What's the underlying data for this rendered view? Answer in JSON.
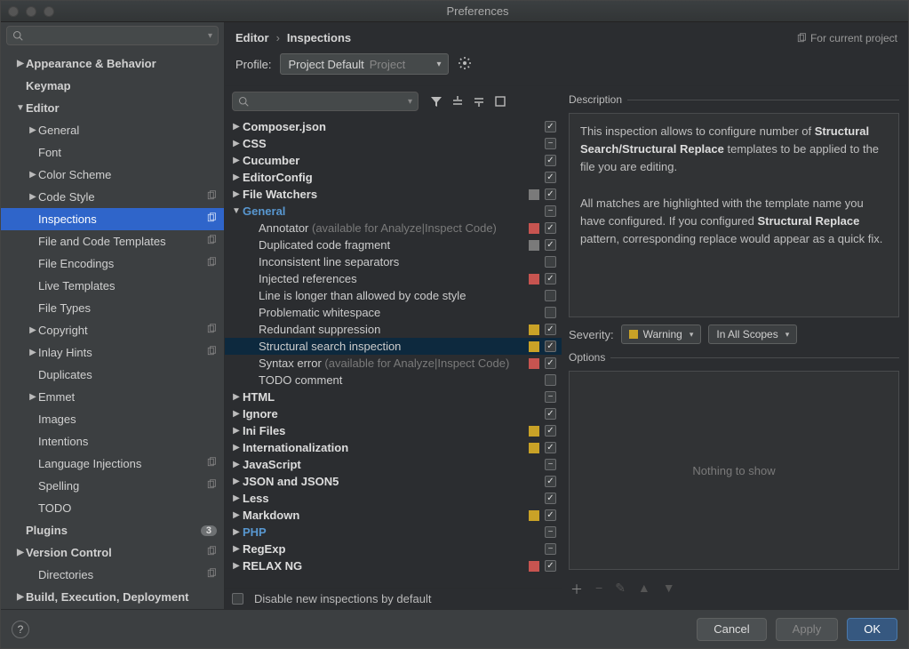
{
  "window": {
    "title": "Preferences"
  },
  "sidebar": {
    "search_placeholder": "",
    "groups": [
      {
        "label": "Appearance & Behavior",
        "bold": true,
        "indent": 0,
        "arrow": "▶"
      },
      {
        "label": "Keymap",
        "bold": true,
        "indent": 0
      },
      {
        "label": "Editor",
        "bold": true,
        "indent": 0,
        "arrow": "▼"
      },
      {
        "label": "General",
        "indent": 1,
        "arrow": "▶"
      },
      {
        "label": "Font",
        "indent": 1
      },
      {
        "label": "Color Scheme",
        "indent": 1,
        "arrow": "▶"
      },
      {
        "label": "Code Style",
        "indent": 1,
        "arrow": "▶",
        "copy": true
      },
      {
        "label": "Inspections",
        "indent": 1,
        "selected": true,
        "copy": true
      },
      {
        "label": "File and Code Templates",
        "indent": 1,
        "copy": true
      },
      {
        "label": "File Encodings",
        "indent": 1,
        "copy": true
      },
      {
        "label": "Live Templates",
        "indent": 1
      },
      {
        "label": "File Types",
        "indent": 1
      },
      {
        "label": "Copyright",
        "indent": 1,
        "arrow": "▶",
        "copy": true
      },
      {
        "label": "Inlay Hints",
        "indent": 1,
        "arrow": "▶",
        "copy": true
      },
      {
        "label": "Duplicates",
        "indent": 1
      },
      {
        "label": "Emmet",
        "indent": 1,
        "arrow": "▶"
      },
      {
        "label": "Images",
        "indent": 1
      },
      {
        "label": "Intentions",
        "indent": 1
      },
      {
        "label": "Language Injections",
        "indent": 1,
        "copy": true
      },
      {
        "label": "Spelling",
        "indent": 1,
        "copy": true
      },
      {
        "label": "TODO",
        "indent": 1
      },
      {
        "label": "Plugins",
        "bold": true,
        "indent": 0,
        "badge": "3"
      },
      {
        "label": "Version Control",
        "bold": true,
        "indent": 0,
        "arrow": "▶",
        "copy": true
      },
      {
        "label": "Directories",
        "indent": 1,
        "copy": true
      },
      {
        "label": "Build, Execution, Deployment",
        "bold": true,
        "indent": 0,
        "arrow": "▶"
      }
    ]
  },
  "breadcrumb": {
    "a": "Editor",
    "sep": "›",
    "b": "Inspections",
    "current_project": "For current project"
  },
  "profile": {
    "label": "Profile:",
    "name": "Project Default",
    "scope": "Project"
  },
  "inspections": {
    "items": [
      {
        "label": "Composer.json",
        "bold": true,
        "indent": 0,
        "arrow": "▶",
        "cb": "checked"
      },
      {
        "label": "CSS",
        "bold": true,
        "indent": 0,
        "arrow": "▶",
        "cb": "mixed"
      },
      {
        "label": "Cucumber",
        "bold": true,
        "indent": 0,
        "arrow": "▶",
        "cb": "checked"
      },
      {
        "label": "EditorConfig",
        "bold": true,
        "indent": 0,
        "arrow": "▶",
        "cb": "checked"
      },
      {
        "label": "File Watchers",
        "bold": true,
        "indent": 0,
        "arrow": "▶",
        "sev": "none",
        "cb": "checked"
      },
      {
        "label": "General",
        "bold": true,
        "blue": true,
        "indent": 0,
        "arrow": "▼",
        "cb": "mixed"
      },
      {
        "label": "Annotator",
        "dim": "(available for Analyze|Inspect Code)",
        "indent": 1,
        "sev": "err",
        "cb": "checked"
      },
      {
        "label": "Duplicated code fragment",
        "indent": 1,
        "sev": "none",
        "cb": "checked"
      },
      {
        "label": "Inconsistent line separators",
        "indent": 1,
        "cb": ""
      },
      {
        "label": "Injected references",
        "indent": 1,
        "sev": "err",
        "cb": "checked"
      },
      {
        "label": "Line is longer than allowed by code style",
        "indent": 1,
        "cb": ""
      },
      {
        "label": "Problematic whitespace",
        "indent": 1,
        "cb": ""
      },
      {
        "label": "Redundant suppression",
        "indent": 1,
        "sev": "warn",
        "cb": "checked"
      },
      {
        "label": "Structural search inspection",
        "indent": 1,
        "sev": "warn",
        "cb": "checked",
        "selected": true
      },
      {
        "label": "Syntax error",
        "dim": "(available for Analyze|Inspect Code)",
        "indent": 1,
        "sev": "err",
        "cb": "checked"
      },
      {
        "label": "TODO comment",
        "indent": 1,
        "cb": ""
      },
      {
        "label": "HTML",
        "bold": true,
        "indent": 0,
        "arrow": "▶",
        "cb": "mixed"
      },
      {
        "label": "Ignore",
        "bold": true,
        "indent": 0,
        "arrow": "▶",
        "cb": "checked"
      },
      {
        "label": "Ini Files",
        "bold": true,
        "indent": 0,
        "arrow": "▶",
        "sev": "warn",
        "cb": "checked"
      },
      {
        "label": "Internationalization",
        "bold": true,
        "indent": 0,
        "arrow": "▶",
        "sev": "warn",
        "cb": "checked"
      },
      {
        "label": "JavaScript",
        "bold": true,
        "indent": 0,
        "arrow": "▶",
        "cb": "mixed"
      },
      {
        "label": "JSON and JSON5",
        "bold": true,
        "indent": 0,
        "arrow": "▶",
        "cb": "checked"
      },
      {
        "label": "Less",
        "bold": true,
        "indent": 0,
        "arrow": "▶",
        "cb": "checked"
      },
      {
        "label": "Markdown",
        "bold": true,
        "indent": 0,
        "arrow": "▶",
        "sev": "warn",
        "cb": "checked"
      },
      {
        "label": "PHP",
        "bold": true,
        "blue": true,
        "indent": 0,
        "arrow": "▶",
        "cb": "mixed"
      },
      {
        "label": "RegExp",
        "bold": true,
        "indent": 0,
        "arrow": "▶",
        "cb": "mixed"
      },
      {
        "label": "RELAX NG",
        "bold": true,
        "indent": 0,
        "arrow": "▶",
        "sev": "err",
        "cb": "checked"
      }
    ],
    "footer_label": "Disable new inspections by default"
  },
  "right": {
    "desc_label": "Description",
    "desc_html_parts": {
      "p1a": "This inspection allows to configure number of ",
      "p1b": "Structural Search/Structural Replace",
      "p1c": " templates to be applied to the file you are editing.",
      "p2a": "All matches are highlighted with the template name you have configured. If you configured ",
      "p2b": "Structural Replace",
      "p2c": " pattern, corresponding replace would appear as a quick fix."
    },
    "severity_label": "Severity:",
    "severity_value": "Warning",
    "scope_value": "In All Scopes",
    "options_label": "Options",
    "options_empty": "Nothing to show"
  },
  "footer": {
    "help": "?",
    "cancel": "Cancel",
    "apply": "Apply",
    "ok": "OK"
  }
}
